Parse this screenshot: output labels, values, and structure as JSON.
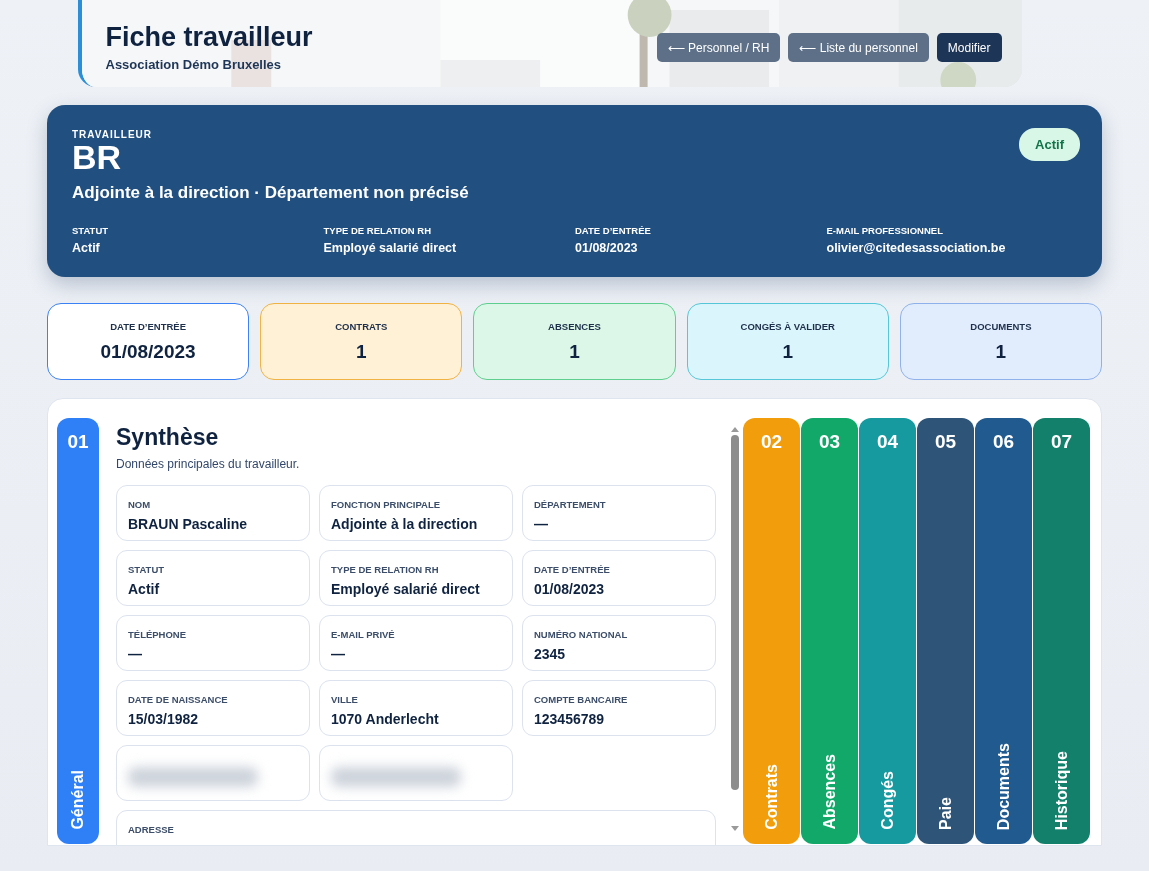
{
  "header": {
    "title": "Fiche travailleur",
    "subtitle": "Association Démo Bruxelles",
    "buttons": [
      {
        "label": "⟵ Personnel / RH",
        "kind": "secondary"
      },
      {
        "label": "⟵ Liste du personnel",
        "kind": "secondary"
      },
      {
        "label": "Modifier",
        "kind": "primary"
      }
    ]
  },
  "hero": {
    "eyebrow": "TRAVAILLEUR",
    "name": "BR",
    "subtitle": "Adjointe à la direction · Département non précisé",
    "badge": "Actif",
    "facts": [
      {
        "label": "STATUT",
        "value": "Actif"
      },
      {
        "label": "TYPE DE RELATION RH",
        "value": "Employé salarié direct"
      },
      {
        "label": "DATE D’ENTRÉE",
        "value": "01/08/2023"
      },
      {
        "label": "E-MAIL PROFESSIONNEL",
        "value": "olivier@citedesassociation.be"
      }
    ]
  },
  "stats": [
    {
      "label": "DATE D’ENTRÉE",
      "value": "01/08/2023",
      "color": "#ffffff"
    },
    {
      "label": "CONTRATS",
      "value": "1",
      "color": "#fff1d6"
    },
    {
      "label": "ABSENCES",
      "value": "1",
      "color": "#dcf7e7"
    },
    {
      "label": "CONGÉS À VALIDER",
      "value": "1",
      "color": "#daf5fb"
    },
    {
      "label": "DOCUMENTS",
      "value": "1",
      "color": "#e1ecfd"
    }
  ],
  "tabs": [
    {
      "number": "01",
      "label": "Général",
      "selected": true,
      "color": "#2f80f7"
    },
    {
      "number": "02",
      "label": "Contrats",
      "selected": false,
      "color": "#f29e0c"
    },
    {
      "number": "03",
      "label": "Absences",
      "selected": false,
      "color": "#12a86a"
    },
    {
      "number": "04",
      "label": "Congés",
      "selected": false,
      "color": "#16999f"
    },
    {
      "number": "05",
      "label": "Paie",
      "selected": false,
      "color": "#2e5478"
    },
    {
      "number": "06",
      "label": "Documents",
      "selected": false,
      "color": "#215a8f"
    },
    {
      "number": "07",
      "label": "Historique",
      "selected": false,
      "color": "#13806b"
    }
  ],
  "section": {
    "title": "Synthèse",
    "description": "Données principales du travailleur.",
    "fields": [
      {
        "kind": "field",
        "label": "NOM",
        "value": "BRAUN Pascaline"
      },
      {
        "kind": "field",
        "label": "FONCTION PRINCIPALE",
        "value": "Adjointe à la direction"
      },
      {
        "kind": "field",
        "label": "DÉPARTEMENT",
        "value": "—"
      },
      {
        "kind": "field",
        "label": "STATUT",
        "value": "Actif"
      },
      {
        "kind": "field",
        "label": "TYPE DE RELATION RH",
        "value": "Employé salarié direct"
      },
      {
        "kind": "field",
        "label": "DATE D’ENTRÉE",
        "value": "01/08/2023"
      },
      {
        "kind": "field",
        "label": "TÉLÉPHONE",
        "value": "—"
      },
      {
        "kind": "field",
        "label": "E-MAIL PRIVÉ",
        "value": "—"
      },
      {
        "kind": "field",
        "label": "NUMÉRO NATIONAL",
        "value": "2345"
      },
      {
        "kind": "field",
        "label": "DATE DE NAISSANCE",
        "value": "15/03/1982"
      },
      {
        "kind": "field",
        "label": "VILLE",
        "value": "1070 Anderlecht"
      },
      {
        "kind": "field",
        "label": "COMPTE BANCAIRE",
        "value": "123456789"
      },
      {
        "kind": "redacted"
      },
      {
        "kind": "redacted"
      },
      {
        "kind": "wide",
        "label": "ADRESSE"
      }
    ]
  }
}
